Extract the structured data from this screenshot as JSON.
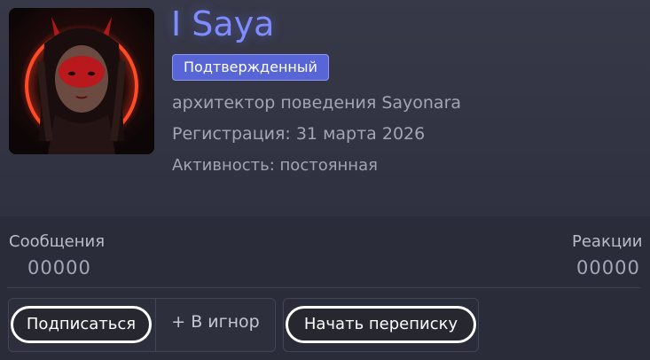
{
  "profile": {
    "name": "I Saya",
    "badge": "Подтвержденный",
    "title": "архитектор поведения Sayonara",
    "registered": "Регистрация: 31 марта 2026",
    "activity": "Активность: постоянная",
    "accent_color": "#7f8cff"
  },
  "stats": {
    "messages_label": "Сообщения",
    "messages_value": "00000",
    "reactions_label": "Реакции",
    "reactions_value": "00000"
  },
  "actions": {
    "subscribe": "Подписаться",
    "ignore": "+ В игнор",
    "start_conversation": "Начать переписку"
  }
}
